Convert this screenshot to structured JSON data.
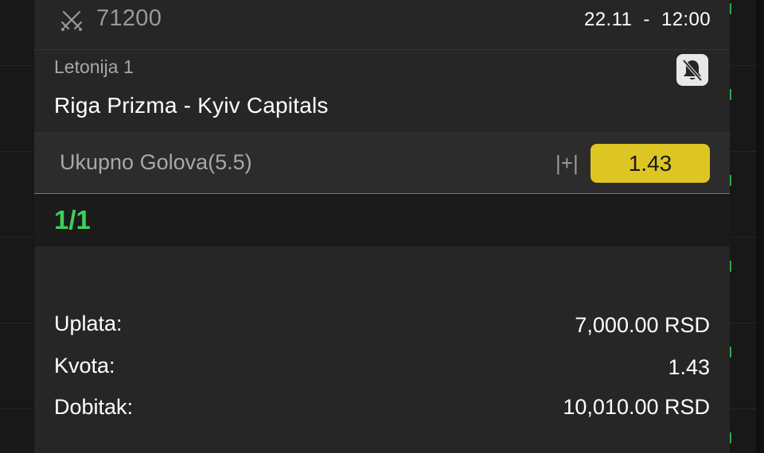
{
  "ticket": {
    "id": "71200",
    "date_time": "22.11  -  12:00",
    "icon": "crossed-swords-icon"
  },
  "event": {
    "league": "Letonija 1",
    "match": "Riga Prizma - Kyiv Capitals",
    "notification_icon": "bell-off-icon"
  },
  "selection": {
    "market": "Ukupno Golova(5.5)",
    "outcome": "|+|",
    "odds": "1.43"
  },
  "count": "1/1",
  "summary": {
    "stake_label": "Uplata:",
    "stake_value": "7,000.00 RSD",
    "odds_label": "Kvota:",
    "odds_value": "1.43",
    "win_label": "Dobitak:",
    "win_value": "10,010.00 RSD"
  },
  "colors": {
    "accent_green": "#3fcf5a",
    "odds_yellow": "#ddc624",
    "card_bg": "#262626"
  }
}
